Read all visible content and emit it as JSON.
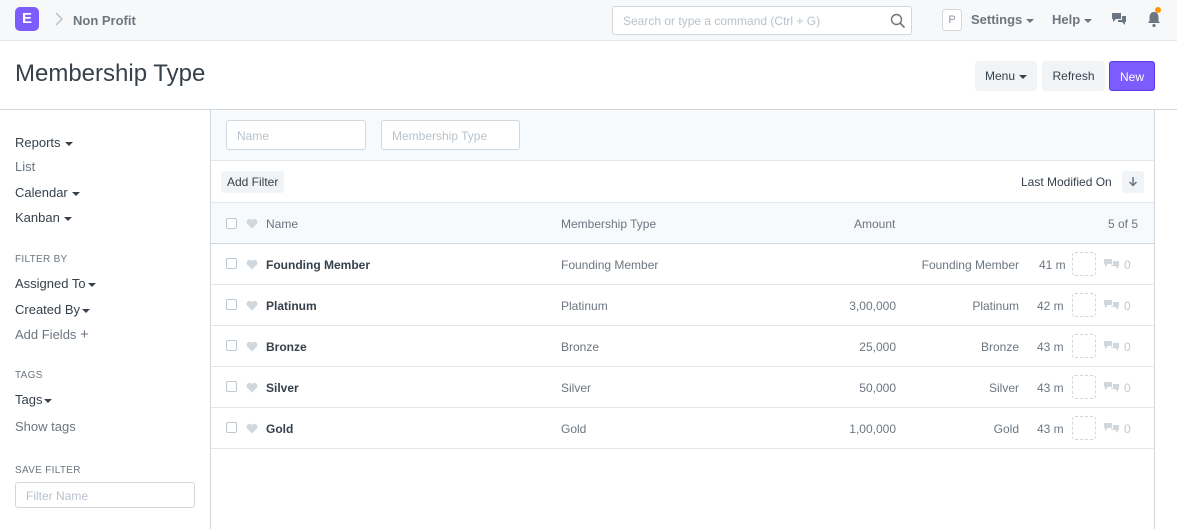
{
  "navbar": {
    "logo_letter": "E",
    "breadcrumb": "Non Profit",
    "search_placeholder": "Search or type a command (Ctrl + G)",
    "avatar_letter": "P",
    "settings_label": "Settings",
    "help_label": "Help",
    "accent_color": "#7c5cfc",
    "notification_dot_color": "#ff9800"
  },
  "page": {
    "title": "Membership Type",
    "menu_label": "Menu",
    "refresh_label": "Refresh",
    "new_label": "New"
  },
  "sidebar": {
    "views": [
      {
        "label": "Reports",
        "dropdown": true
      },
      {
        "label": "List",
        "dropdown": false
      },
      {
        "label": "Calendar",
        "dropdown": true
      },
      {
        "label": "Kanban",
        "dropdown": true
      }
    ],
    "filter_by_label": "FILTER BY",
    "assigned_to": "Assigned To",
    "created_by": "Created By",
    "add_fields": "Add Fields",
    "tags_label": "TAGS",
    "tags": "Tags",
    "show_tags": "Show tags",
    "save_filter_label": "SAVE FILTER",
    "filter_name_placeholder": "Filter Name"
  },
  "filters": {
    "name_placeholder": "Name",
    "membership_type_placeholder": "Membership Type",
    "add_filter": "Add Filter",
    "sort_label": "Last Modified On"
  },
  "table": {
    "headers": {
      "name": "Name",
      "membership_type": "Membership Type",
      "amount": "Amount",
      "count": "5 of 5"
    },
    "rows": [
      {
        "name": "Founding Member",
        "membership_type": "Founding Member",
        "amount": "",
        "title_right": "Founding Member",
        "modified": "41 m",
        "comments": "0"
      },
      {
        "name": "Platinum",
        "membership_type": "Platinum",
        "amount": "3,00,000",
        "title_right": "Platinum",
        "modified": "42 m",
        "comments": "0"
      },
      {
        "name": "Bronze",
        "membership_type": "Bronze",
        "amount": "25,000",
        "title_right": "Bronze",
        "modified": "43 m",
        "comments": "0"
      },
      {
        "name": "Silver",
        "membership_type": "Silver",
        "amount": "50,000",
        "title_right": "Silver",
        "modified": "43 m",
        "comments": "0"
      },
      {
        "name": "Gold",
        "membership_type": "Gold",
        "amount": "1,00,000",
        "title_right": "Gold",
        "modified": "43 m",
        "comments": "0"
      }
    ]
  }
}
